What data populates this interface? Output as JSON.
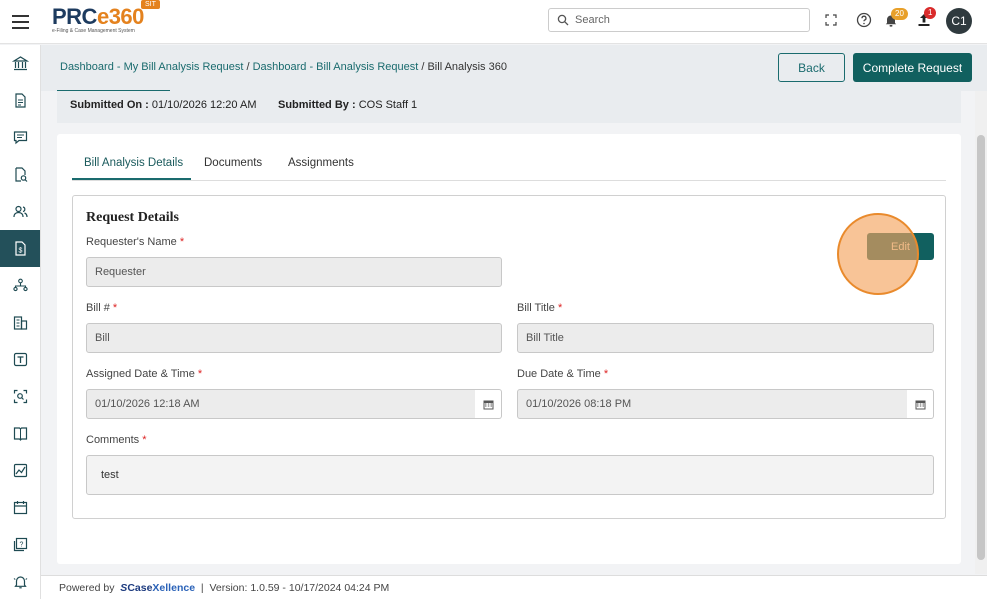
{
  "header": {
    "logo_text_a": "PRC",
    "logo_text_b": "e360",
    "logo_subtitle": "e-Filing & Case Management System",
    "env_badge": "SIT",
    "search_placeholder": "Search",
    "notifications_count": "20",
    "uploads_count": "1",
    "avatar_initials": "C1"
  },
  "sidebar": {
    "items": [
      {
        "icon": "bank-icon"
      },
      {
        "icon": "document-icon"
      },
      {
        "icon": "chat-icon"
      },
      {
        "icon": "document-search-icon"
      },
      {
        "icon": "users-icon"
      },
      {
        "icon": "bill-dollar-icon",
        "active": true
      },
      {
        "icon": "hierarchy-icon"
      },
      {
        "icon": "building-icon"
      },
      {
        "icon": "text-box-icon"
      },
      {
        "icon": "scan-search-icon"
      },
      {
        "icon": "book-icon"
      },
      {
        "icon": "chart-image-icon"
      },
      {
        "icon": "calendar-icon"
      },
      {
        "icon": "help-copy-icon"
      },
      {
        "icon": "bell-alert-icon"
      }
    ]
  },
  "breadcrumb": {
    "item1": "Dashboard - My Bill Analysis Request",
    "sep1": " / ",
    "item2": "Dashboard - Bill Analysis Request",
    "sep2": " / ",
    "current": "Bill Analysis 360"
  },
  "actions": {
    "back_label": "Back",
    "complete_label": "Complete Request"
  },
  "submitted": {
    "on_label": "Submitted On :",
    "on_value": "01/10/2026 12:20 AM",
    "by_label": "Submitted By :",
    "by_value": "COS Staff 1"
  },
  "tabs": [
    {
      "label": "Bill Analysis Details",
      "active": true
    },
    {
      "label": "Documents"
    },
    {
      "label": "Assignments"
    }
  ],
  "request_details": {
    "title": "Request Details",
    "edit_label": "Edit",
    "requester_label": "Requester's Name",
    "requester_value": "Requester",
    "bill_label": "Bill #",
    "bill_value": "Bill",
    "bill_title_label": "Bill Title",
    "bill_title_value": "Bill Title",
    "assigned_label": "Assigned Date & Time",
    "assigned_value": "01/10/2026 12:18 AM",
    "due_label": "Due Date & Time",
    "due_value": "01/10/2026  08:18 PM",
    "comments_label": "Comments",
    "comments_value": "test",
    "required_mark": "*"
  },
  "footer": {
    "powered_by": "Powered by",
    "brand_a": "Case",
    "brand_b": "Xellence",
    "separator": "|",
    "version": "Version: 1.0.59 - 10/17/2024 04:24 PM"
  },
  "colors": {
    "primary": "#11605f",
    "link": "#1a6b6e",
    "accent_orange": "#e4821e",
    "sidebar_active": "#23505a"
  }
}
